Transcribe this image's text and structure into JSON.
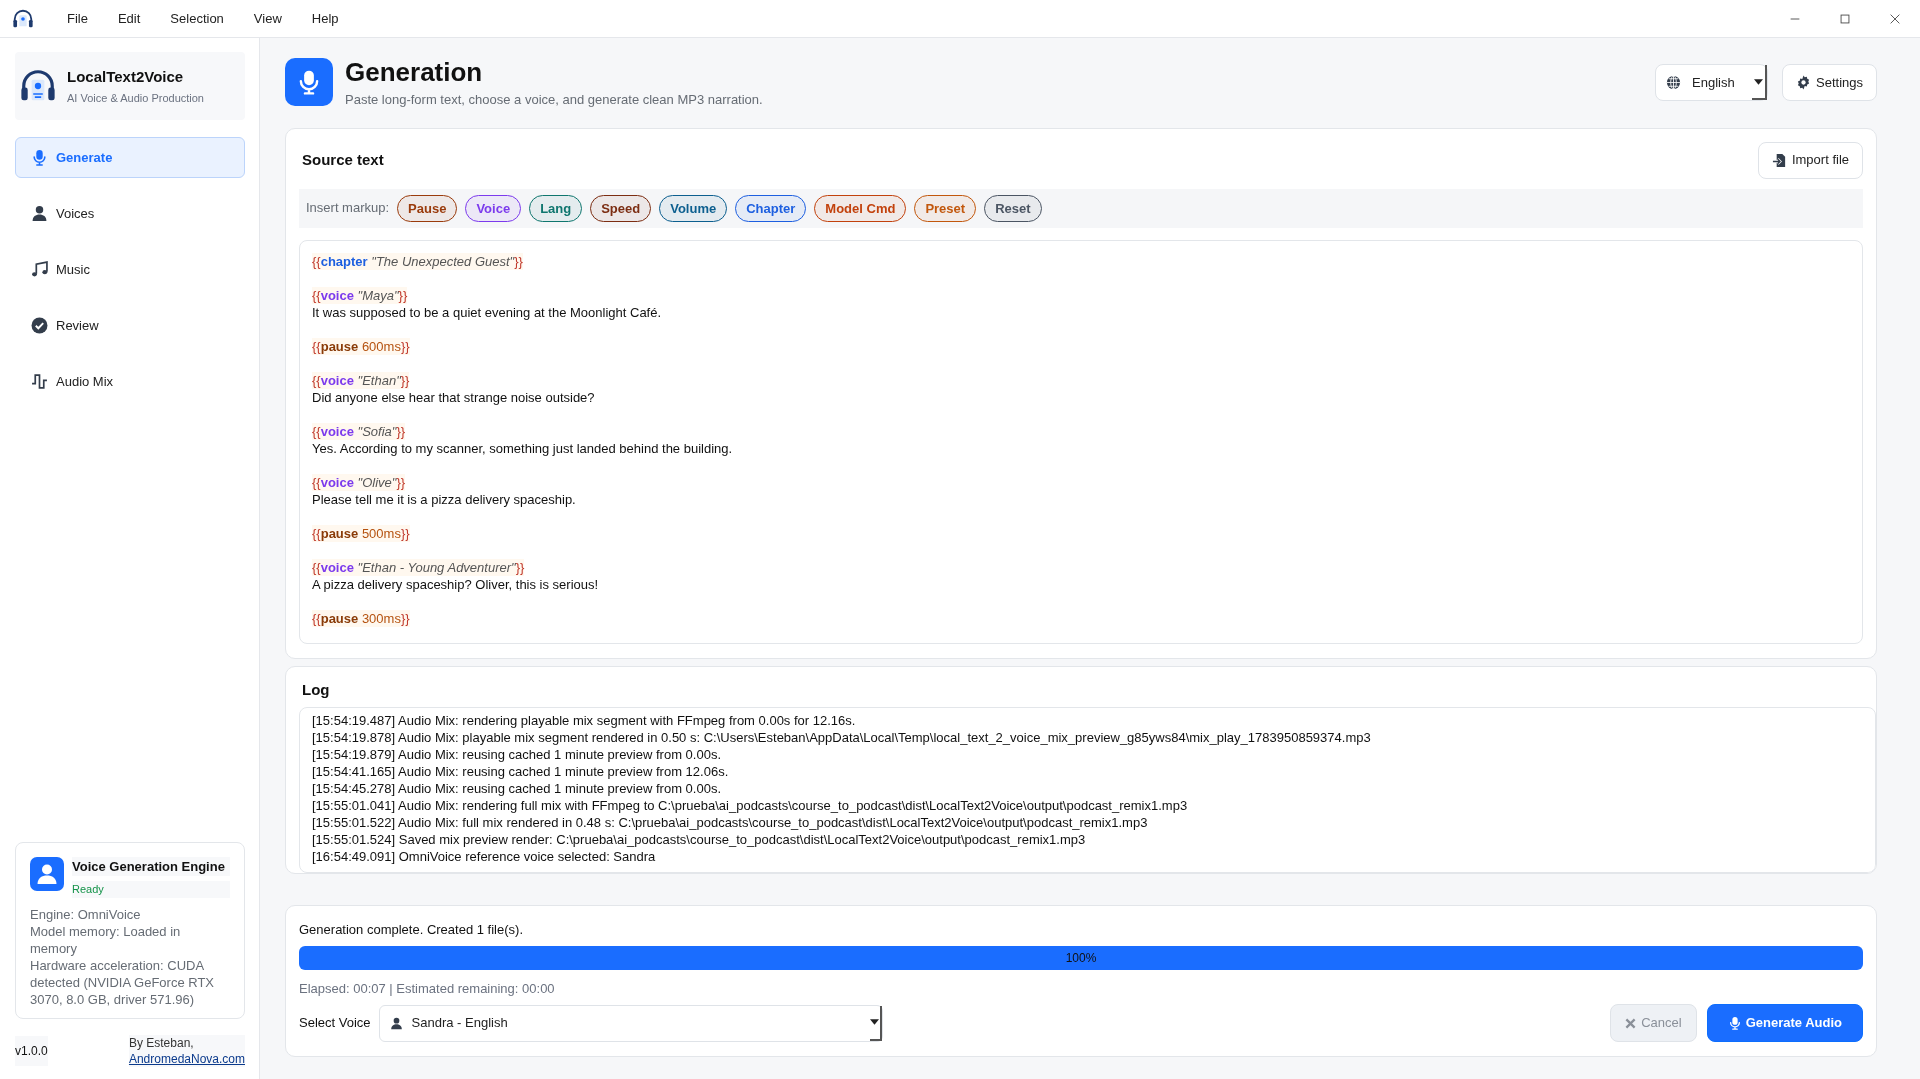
{
  "menu": [
    "File",
    "Edit",
    "Selection",
    "View",
    "Help"
  ],
  "brand": {
    "name": "LocalText2Voice",
    "tagline": "AI Voice & Audio Production"
  },
  "sidebar": {
    "items": [
      {
        "label": "Generate",
        "selected": true
      },
      {
        "label": "Voices",
        "selected": false
      },
      {
        "label": "Music",
        "selected": false
      },
      {
        "label": "Review",
        "selected": false
      },
      {
        "label": "Audio Mix",
        "selected": false
      }
    ]
  },
  "engine": {
    "title": "Voice Generation Engine",
    "status": "Ready",
    "details": [
      "Engine: OmniVoice",
      "Model memory: Loaded in memory",
      "Hardware acceleration: CUDA detected (NVIDIA GeForce RTX 3070, 8.0 GB, driver 571.96)"
    ]
  },
  "footer": {
    "version": "v1.0.0",
    "credit": "By Esteban,",
    "link": "AndromedaNova.com"
  },
  "header": {
    "title": "Generation",
    "subtitle": "Paste long-form text, choose a voice, and generate clean MP3 narration.",
    "language": "English",
    "settings": "Settings"
  },
  "source": {
    "title": "Source text",
    "import": "Import file",
    "markup_label": "Insert markup:",
    "markup_buttons": [
      {
        "label": "Pause",
        "color": "#9a3b0c"
      },
      {
        "label": "Voice",
        "color": "#7c3aed"
      },
      {
        "label": "Lang",
        "color": "#0f766e"
      },
      {
        "label": "Speed",
        "color": "#7c2d12"
      },
      {
        "label": "Volume",
        "color": "#0c5f8f"
      },
      {
        "label": "Chapter",
        "color": "#1d5fe0"
      },
      {
        "label": "Model Cmd",
        "color": "#c2410c"
      },
      {
        "label": "Preset",
        "color": "#c2570c"
      },
      {
        "label": "Reset",
        "color": "#4b5563"
      }
    ],
    "blocks": [
      {
        "tag": {
          "kind": "chapter",
          "open": "{{",
          "command": "chapter",
          "argument": "\"The Unexpected Guest\"",
          "close": "}}"
        }
      },
      {
        "tag": {
          "kind": "voice",
          "open": "{{",
          "command": "voice",
          "argument": "\"Maya\"",
          "close": "}}"
        },
        "text": "It was supposed to be a quiet evening at the Moonlight Café."
      },
      {
        "tag": {
          "kind": "pause",
          "open": "{{",
          "command": "pause",
          "argument": "600ms",
          "close": "}}"
        }
      },
      {
        "tag": {
          "kind": "voice",
          "open": "{{",
          "command": "voice",
          "argument": "\"Ethan\"",
          "close": "}}"
        },
        "text": "Did anyone else hear that strange noise outside?"
      },
      {
        "tag": {
          "kind": "voice",
          "open": "{{",
          "command": "voice",
          "argument": "\"Sofia\"",
          "close": "}}"
        },
        "text": "Yes. According to my scanner, something just landed behind the building."
      },
      {
        "tag": {
          "kind": "voice",
          "open": "{{",
          "command": "voice",
          "argument": "\"Olive\"",
          "close": "}}"
        },
        "text": "Please tell me it is a pizza delivery spaceship."
      },
      {
        "tag": {
          "kind": "pause",
          "open": "{{",
          "command": "pause",
          "argument": "500ms",
          "close": "}}"
        }
      },
      {
        "tag": {
          "kind": "voice",
          "open": "{{",
          "command": "voice",
          "argument": "\"Ethan - Young Adventurer\"",
          "close": "}}"
        },
        "text": "A pizza delivery spaceship? Oliver, this is serious!"
      },
      {
        "tag": {
          "kind": "pause",
          "open": "{{",
          "command": "pause",
          "argument": "300ms",
          "close": "}}"
        }
      }
    ]
  },
  "log": {
    "title": "Log",
    "lines": [
      "[15:54:19.487] Audio Mix: rendering playable mix segment with FFmpeg from 0.00s for 12.16s.",
      "[15:54:19.878] Audio Mix: playable mix segment rendered in 0.50 s: C:\\Users\\Esteban\\AppData\\Local\\Temp\\local_text_2_voice_mix_preview_g85yws84\\mix_play_1783950859374.mp3",
      "[15:54:19.879] Audio Mix: reusing cached 1 minute preview from 0.00s.",
      "[15:54:41.165] Audio Mix: reusing cached 1 minute preview from 12.06s.",
      "[15:54:45.278] Audio Mix: reusing cached 1 minute preview from 0.00s.",
      "[15:55:01.041] Audio Mix: rendering full mix with FFmpeg to C:\\prueba\\ai_podcasts\\course_to_podcast\\dist\\LocalText2Voice\\output\\podcast_remix1.mp3",
      "[15:55:01.522] Audio Mix: full mix rendered in 0.48 s: C:\\prueba\\ai_podcasts\\course_to_podcast\\dist\\LocalText2Voice\\output\\podcast_remix1.mp3",
      "[15:55:01.524] Saved mix preview render: C:\\prueba\\ai_podcasts\\course_to_podcast\\dist\\LocalText2Voice\\output\\podcast_remix1.mp3",
      "[16:54:49.091] OmniVoice reference voice selected: Sandra"
    ]
  },
  "generation": {
    "status": "Generation complete. Created 1 file(s).",
    "progress": {
      "level": 1,
      "label": "100%"
    },
    "timing": "Elapsed: 00:07 | Estimated remaining: 00:00",
    "voice_label": "Select Voice",
    "voice": "Sandra - English",
    "cancel": {
      "label": "Cancel",
      "disabled": true
    },
    "generate": "Generate Audio"
  }
}
